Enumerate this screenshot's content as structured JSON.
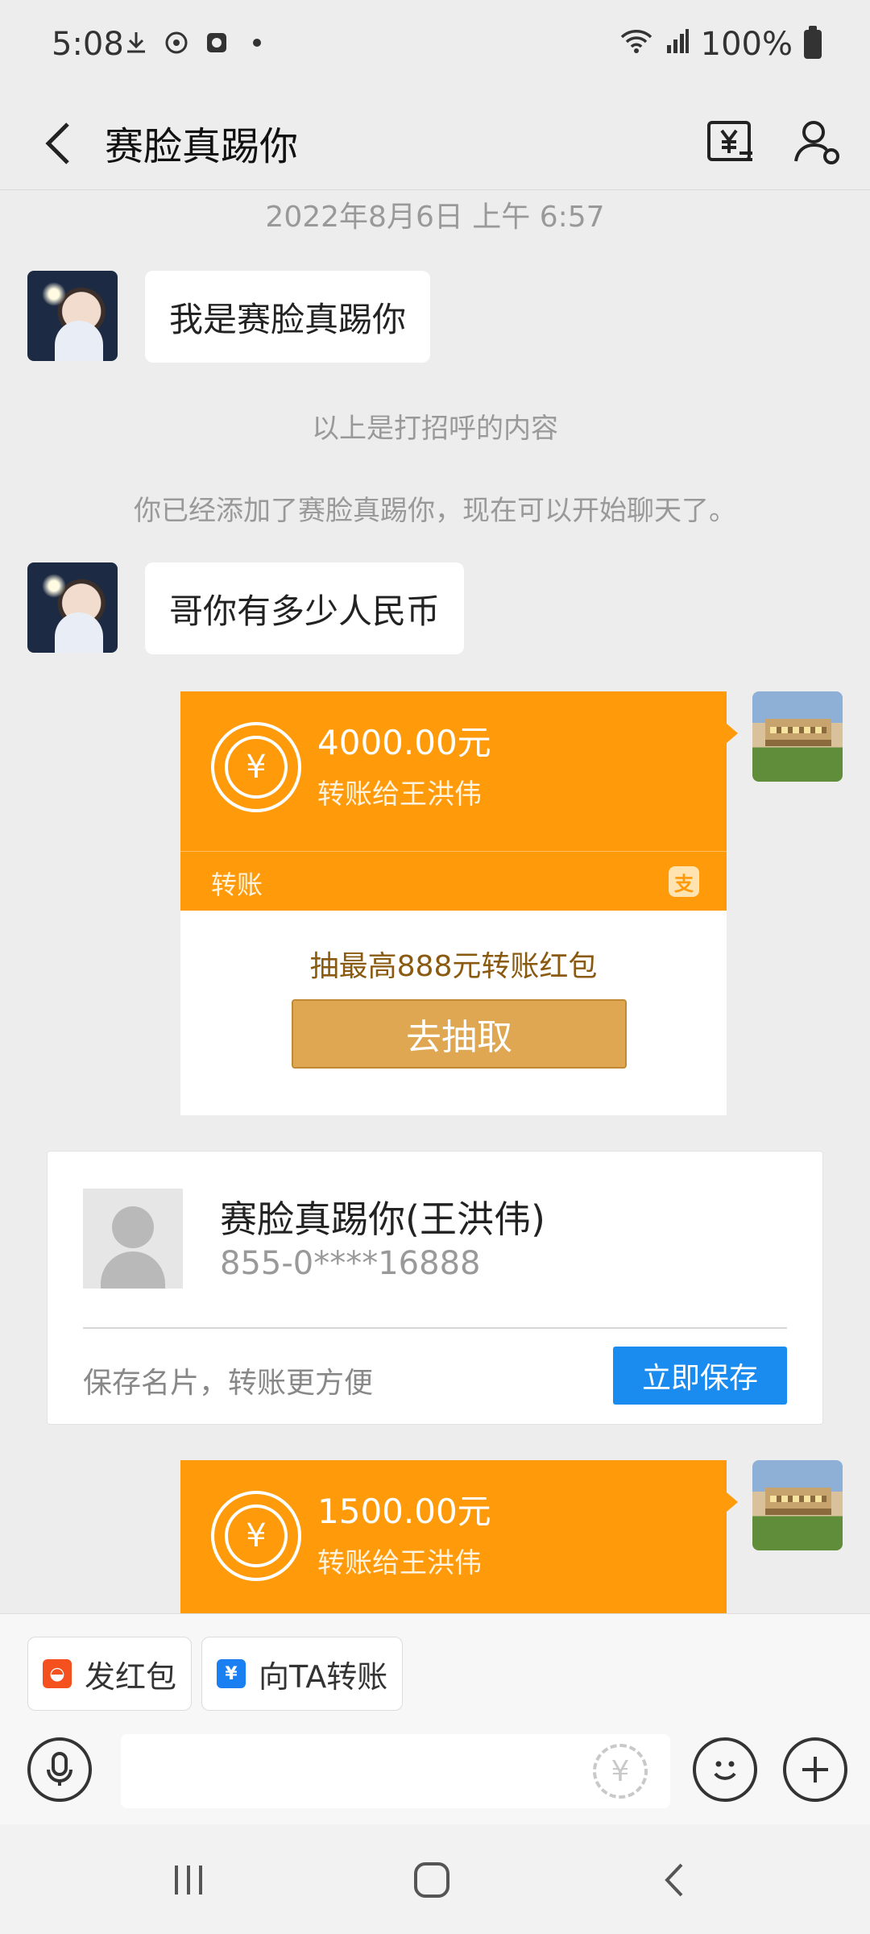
{
  "status_bar": {
    "time": "5:08",
    "battery": "100%"
  },
  "header": {
    "title": "赛脸真踢你"
  },
  "chat": {
    "timestamp": "2022年8月6日 上午 6:57",
    "messages": {
      "greeting": "我是赛脸真踢你",
      "question": "哥你有多少人民币"
    },
    "system": {
      "greeting_note": "以上是打招呼的内容",
      "added_note": "你已经添加了赛脸真踢你，现在可以开始聊天了。"
    },
    "transfer1": {
      "amount": "4000.00元",
      "desc": "转账给王洪伟",
      "label": "转账",
      "promo": "抽最高888元转账红包",
      "button": "去抽取"
    },
    "contact_card": {
      "name": "赛脸真踢你(王洪伟)",
      "phone": "855-0****16888",
      "hint": "保存名片，转账更方便",
      "save_button": "立即保存"
    },
    "transfer2": {
      "amount": "1500.00元",
      "desc": "转账给王洪伟"
    }
  },
  "quick_actions": {
    "red_packet": "发红包",
    "transfer": "向TA转账"
  },
  "colors": {
    "transfer_orange": "#ff9a0a",
    "save_blue": "#1a8cf0",
    "draw_button": "#e0a752"
  }
}
